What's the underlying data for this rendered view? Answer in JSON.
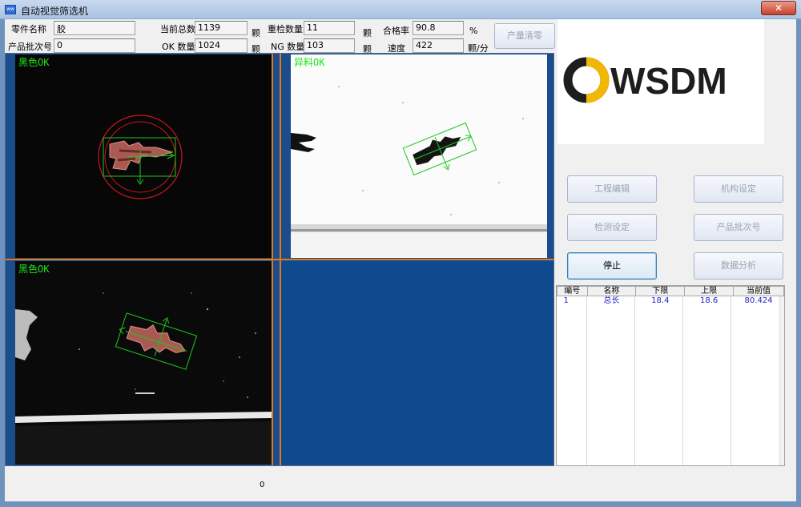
{
  "window": {
    "title": "自动视觉筛选机",
    "icon_text": "ww",
    "close_symbol": "✕"
  },
  "info": {
    "part_name_label": "零件名称",
    "part_name_value": "胶",
    "batch_label": "产品批次号",
    "batch_value": "0",
    "total_label": "当前总数",
    "total_value": "1139",
    "total_unit": "颗",
    "ok_label": "OK 数量",
    "ok_value": "1024",
    "ok_unit": "颗",
    "recheck_label": "重检数量",
    "recheck_value": "11",
    "recheck_unit": "颗",
    "ng_label": "NG 数量",
    "ng_value": "103",
    "ng_unit": "颗",
    "pass_label": "合格率",
    "pass_value": "90.8",
    "pass_unit": "%",
    "speed_label": "速度",
    "speed_value": "422",
    "speed_unit": "颗/分",
    "clear_button": "产量清零"
  },
  "cameras": [
    {
      "label": "黑色OK"
    },
    {
      "label": "异料OK"
    },
    {
      "label": "黑色OK"
    }
  ],
  "logo": {
    "text": "WSDM",
    "colors": {
      "ring": "#1e1e1e",
      "accent": "#f2b705"
    }
  },
  "buttons": {
    "project_edit": "工程编辑",
    "mechanism": "机构设定",
    "detect_setting": "检测设定",
    "product_batch": "产品批次号",
    "stop": "停止",
    "data_analysis": "数据分析"
  },
  "table": {
    "headers": [
      "编号",
      "名称",
      "下限",
      "上限",
      "当前值"
    ],
    "rows": [
      [
        "1",
        "总长",
        "18.4",
        "18.6",
        "80.424"
      ]
    ]
  },
  "status": {
    "value": "0"
  },
  "colors": {
    "viewport_bg": "#1b4d8c",
    "divider": "#e07a1a",
    "ok_text": "#19e619",
    "table_text": "#2323c8"
  }
}
